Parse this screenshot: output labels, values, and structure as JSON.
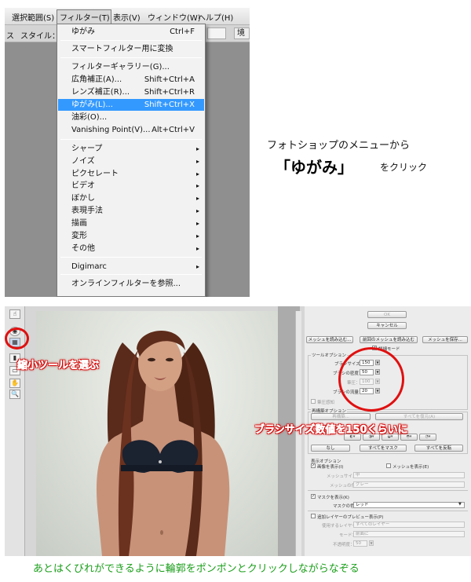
{
  "menubar": {
    "items": [
      {
        "label": "選択範囲(S)"
      },
      {
        "label": "フィルター(T)"
      },
      {
        "label": "表示(V)"
      },
      {
        "label": "ウィンドウ(W)"
      },
      {
        "label": "ヘルプ(H)"
      }
    ]
  },
  "options_bar": {
    "left_text": "ス",
    "style_label": "スタイル：",
    "right_text": "境"
  },
  "filter_menu": {
    "items": [
      {
        "label": "ゆがみ",
        "shortcut": "Ctrl+F"
      },
      {
        "label": "スマートフィルター用に変換",
        "shortcut": ""
      },
      {
        "label": "フィルターギャラリー(G)...",
        "shortcut": ""
      },
      {
        "label": "広角補正(A)...",
        "shortcut": "Shift+Ctrl+A"
      },
      {
        "label": "レンズ補正(R)...",
        "shortcut": "Shift+Ctrl+R"
      },
      {
        "label": "ゆがみ(L)...",
        "shortcut": "Shift+Ctrl+X",
        "selected": true
      },
      {
        "label": "油彩(O)...",
        "shortcut": ""
      },
      {
        "label": "Vanishing Point(V)...",
        "shortcut": "Alt+Ctrl+V"
      },
      {
        "label": "シャープ",
        "submenu": true
      },
      {
        "label": "ノイズ",
        "submenu": true
      },
      {
        "label": "ピクセレート",
        "submenu": true
      },
      {
        "label": "ビデオ",
        "submenu": true
      },
      {
        "label": "ぼかし",
        "submenu": true
      },
      {
        "label": "表現手法",
        "submenu": true
      },
      {
        "label": "描画",
        "submenu": true
      },
      {
        "label": "変形",
        "submenu": true
      },
      {
        "label": "その他",
        "submenu": true
      },
      {
        "label": "Digimarc",
        "submenu": true
      },
      {
        "label": "オンラインフィルターを参照..."
      }
    ],
    "submenu_arrow": "▸"
  },
  "caption_top": {
    "line1": "フォトショップのメニューから",
    "line2": "「ゆがみ」",
    "line2_suffix": "をクリック"
  },
  "liquify": {
    "tools": [
      "☝",
      "◉",
      "▦",
      "▮",
      "▭",
      "✋",
      "🔍"
    ],
    "ok_label": "OK",
    "cancel_label": "キャンセル",
    "load_mesh": "メッシュを読み込む...",
    "load_last_mesh": "前回のメッシュを読み込む",
    "save_mesh": "メッシュを保存...",
    "advanced_mode": "詳細モード",
    "tool_options_title": "ツールオプション",
    "brush_size_label": "ブラシサイズ：",
    "brush_size_value": "150",
    "brush_density_label": "ブラシの密度：",
    "brush_density_value": "50",
    "pressure_label": "筆圧：",
    "pressure_value": "100",
    "brush_rate_label": "ブラシの流量：",
    "brush_rate_value": "20",
    "stylus_label": "筆圧感知",
    "reconstruct_title": "再構築オプション",
    "reconstruct_btn": "再構築...",
    "restore_all_btn": "すべてを復元(A)",
    "none_btn": "なし",
    "mask_all_btn": "すべてをマスク",
    "invert_all_btn": "すべてを反転",
    "view_title": "表示オプション",
    "show_image": "画像を表示(I)",
    "show_mesh": "メッシュを表示(E)",
    "mesh_size_label": "メッシュサイズ：",
    "mesh_size_value": "中",
    "mesh_color_label": "メッシュの色：",
    "mesh_color_value": "グレー",
    "show_mask": "マスクを表示(K)",
    "mask_color_label": "マスクの色：",
    "mask_color_value": "レッド",
    "backdrop": "追加レイヤーのプレビュー表示(P)",
    "use_label": "使用するレイヤー：",
    "use_value": "すべてのレイヤー",
    "mode_label": "モード：",
    "mode_value": "前面に",
    "opacity_label": "不透明度：",
    "opacity_value": "50"
  },
  "annotations": {
    "tool": "縮小ツールを選ぶ",
    "brush": "ブラシサイズ数値を150くらいに"
  },
  "caption_bottom": "あとはくびれができるように輪郭をポンポンとクリックしながらなぞる",
  "colors": {
    "highlight": "#3399ff",
    "annotation": "#e01010",
    "caption_green": "#1a9e1a"
  }
}
